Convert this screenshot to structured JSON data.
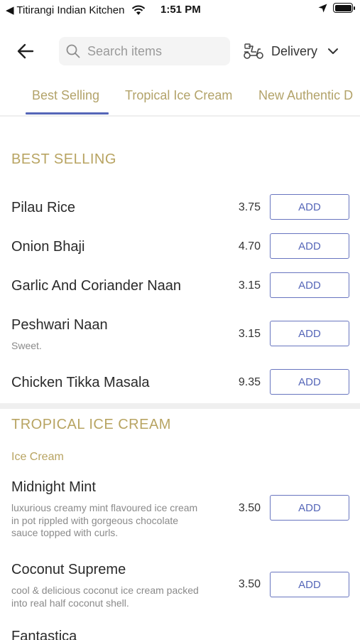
{
  "status_bar": {
    "back_app": "◀ Titirangi Indian Kitchen",
    "time": "1:51 PM"
  },
  "header": {
    "search_placeholder": "Search items",
    "delivery_label": "Delivery"
  },
  "tabs": [
    {
      "label": "Best Selling",
      "active": true
    },
    {
      "label": "Tropical Ice Cream",
      "active": false
    },
    {
      "label": "New Authentic D",
      "active": false
    }
  ],
  "sections": {
    "best_selling": {
      "title": "BEST SELLING",
      "items": [
        {
          "name": "Pilau Rice",
          "price": "3.75",
          "add_label": "ADD"
        },
        {
          "name": "Onion Bhaji",
          "price": "4.70",
          "add_label": "ADD"
        },
        {
          "name": "Garlic And Coriander Naan",
          "price": "3.15",
          "add_label": "ADD"
        },
        {
          "name": "Peshwari Naan",
          "desc": "Sweet.",
          "price": "3.15",
          "add_label": "ADD"
        },
        {
          "name": "Chicken Tikka Masala",
          "price": "9.35",
          "add_label": "ADD"
        }
      ]
    },
    "tropical_ice_cream": {
      "title": "TROPICAL ICE CREAM",
      "subsection": "Ice Cream",
      "items": [
        {
          "name": "Midnight Mint",
          "desc": "luxurious creamy mint flavoured ice cream in pot rippled with gorgeous chocolate sauce topped with curls.",
          "price": "3.50",
          "add_label": "ADD"
        },
        {
          "name": "Coconut Supreme",
          "desc": "cool & delicious coconut ice cream packed into real half coconut shell.",
          "price": "3.50",
          "add_label": "ADD"
        },
        {
          "name": "Fantastica"
        }
      ]
    }
  },
  "colors": {
    "accent_gold": "#b8a462",
    "accent_blue": "#5566b8"
  }
}
